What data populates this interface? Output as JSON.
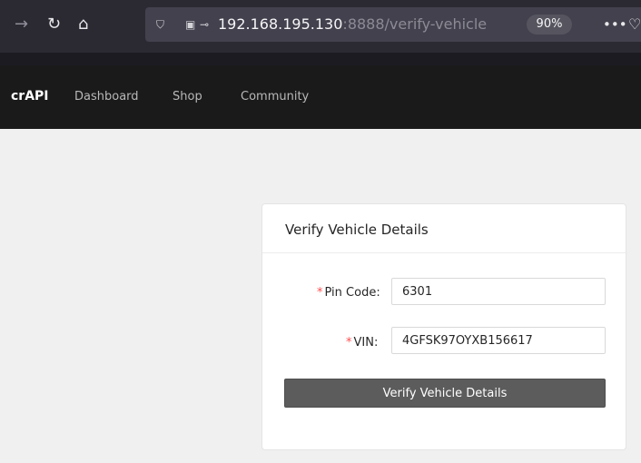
{
  "browser": {
    "url_host": "192.168.195.130",
    "url_rest": ":8888/verify-vehicle",
    "zoom": "90%",
    "icons": {
      "back": "arrow-right-icon",
      "reload": "reload-icon",
      "home": "home-icon",
      "shield": "shield-icon",
      "lock": "lock-icon",
      "key": "key-icon",
      "more": "more-icon",
      "pocket": "pocket-icon"
    }
  },
  "navbar": {
    "brand": "crAPI",
    "links": [
      "Dashboard",
      "Shop",
      "Community"
    ]
  },
  "card": {
    "title": "Verify Vehicle Details",
    "pin": {
      "label": "Pin Code:",
      "value": "6301"
    },
    "vin": {
      "label": "VIN:",
      "value": "4GFSK97OYXB156617"
    },
    "button": "Verify Vehicle Details"
  },
  "colors": {
    "browser_bar": "#2b2a33",
    "navbar": "#1a1a1a",
    "page_background": "#f0f0f0",
    "button": "#5c5c5c",
    "required": "#ff4d4f"
  }
}
